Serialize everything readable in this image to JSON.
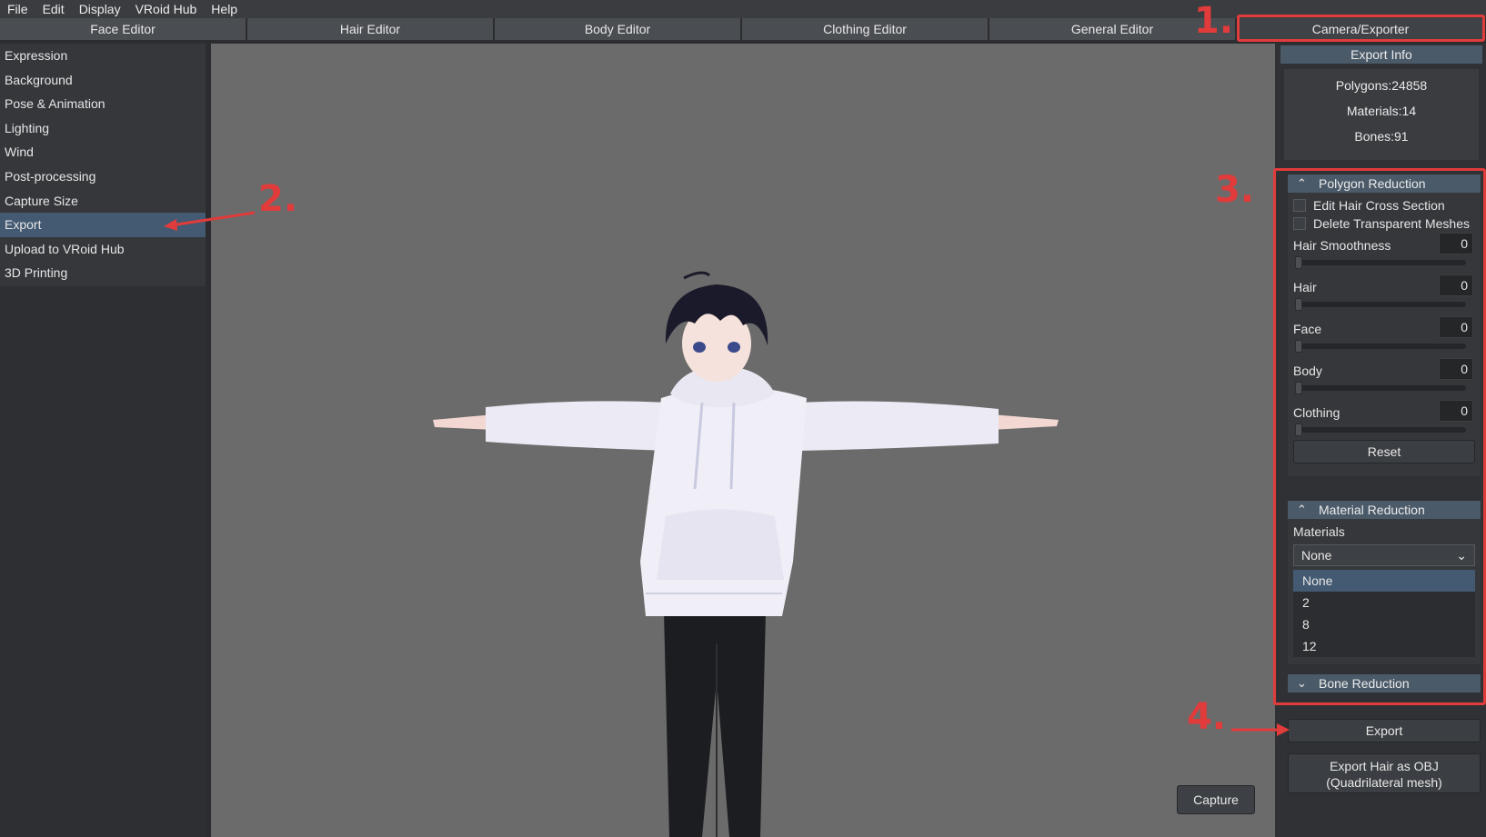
{
  "menu": [
    "File",
    "Edit",
    "Display",
    "VRoid Hub",
    "Help"
  ],
  "tabs": [
    "Face Editor",
    "Hair Editor",
    "Body Editor",
    "Clothing Editor",
    "General Editor",
    "Camera/Exporter"
  ],
  "sidebar": {
    "items": [
      "Expression",
      "Background",
      "Pose & Animation",
      "Lighting",
      "Wind",
      "Post-processing",
      "Capture Size",
      "Export",
      "Upload to VRoid Hub",
      "3D Printing"
    ],
    "selected": "Export"
  },
  "viewport": {
    "capture_label": "Capture"
  },
  "right_panel": {
    "header": "Export Info",
    "info": {
      "polygons": "Polygons:24858",
      "materials": "Materials:14",
      "bones": "Bones:91"
    },
    "polygon_reduction": {
      "title": "Polygon Reduction",
      "checkbox1": "Edit Hair Cross Section",
      "checkbox2": "Delete Transparent Meshes",
      "sliders": [
        {
          "label": "Hair Smoothness",
          "value": "0"
        },
        {
          "label": "Hair",
          "value": "0"
        },
        {
          "label": "Face",
          "value": "0"
        },
        {
          "label": "Body",
          "value": "0"
        },
        {
          "label": "Clothing",
          "value": "0"
        }
      ],
      "reset": "Reset"
    },
    "material_reduction": {
      "title": "Material Reduction",
      "label": "Materials",
      "selected": "None",
      "options": [
        "None",
        "2",
        "8",
        "12"
      ]
    },
    "bone_reduction": {
      "title": "Bone Reduction"
    },
    "export_label": "Export",
    "export_hair_label1": "Export Hair as OBJ",
    "export_hair_label2": "(Quadrilateral mesh)"
  },
  "annotations": {
    "n1": "1.",
    "n2": "2.",
    "n3": "3.",
    "n4": "4."
  },
  "colors": {
    "annotation": "#e13b3b",
    "selected": "#435a72",
    "header": "#4b5a69"
  }
}
